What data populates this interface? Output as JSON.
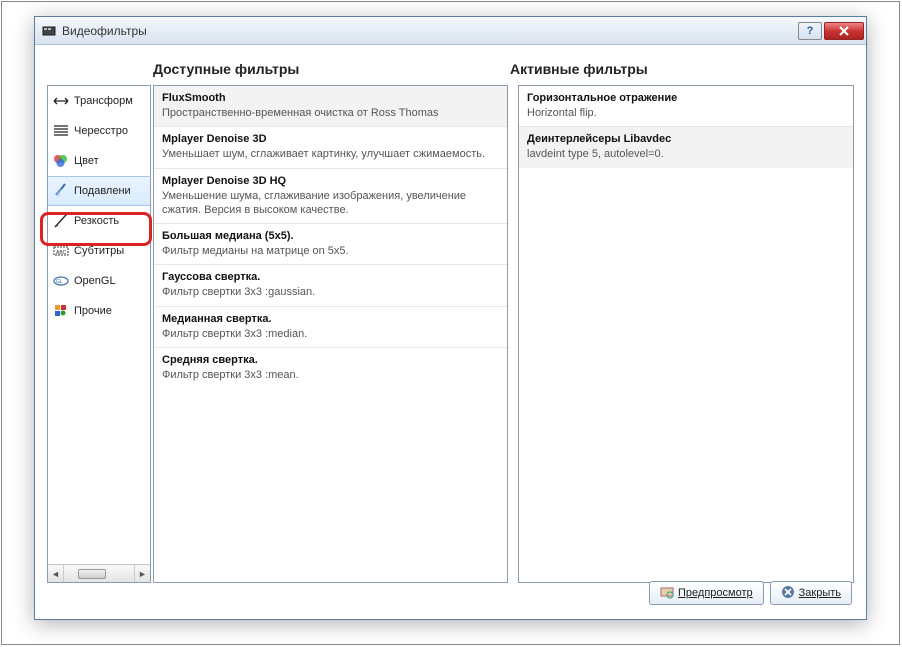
{
  "window": {
    "title": "Видеофильтры"
  },
  "headers": {
    "available": "Доступные фильтры",
    "active": "Активные фильтры"
  },
  "sidebar": {
    "items": [
      {
        "label": "Трансформ",
        "icon": "transform"
      },
      {
        "label": "Чересстро",
        "icon": "interlace"
      },
      {
        "label": "Цвет",
        "icon": "color"
      },
      {
        "label": "Подавлени",
        "icon": "noise"
      },
      {
        "label": "Резкость",
        "icon": "sharp"
      },
      {
        "label": "Субтитры",
        "icon": "subs"
      },
      {
        "label": "OpenGL",
        "icon": "opengl"
      },
      {
        "label": "Прочие",
        "icon": "other"
      }
    ]
  },
  "available": [
    {
      "name": "FluxSmooth",
      "desc": "Пространственно-временная очистка от Ross Thomas"
    },
    {
      "name": "Mplayer Denoise 3D",
      "desc": "Уменьшает шум, сглаживает картинку, улучшает сжимаемость."
    },
    {
      "name": "Mplayer Denoise 3D HQ",
      "desc": "Уменьшение шума, сглаживание изображения, увеличение сжатия. Версия в высоком качестве."
    },
    {
      "name": "Большая медиана (5x5).",
      "desc": "Фильтр медианы на матрице on 5x5."
    },
    {
      "name": "Гауссова свертка.",
      "desc": "Фильтр свертки 3x3 :gaussian."
    },
    {
      "name": "Медианная свертка.",
      "desc": "Фильтр свертки 3x3 :median."
    },
    {
      "name": "Средняя свертка.",
      "desc": "Фильтр свертки 3x3 :mean."
    }
  ],
  "active": [
    {
      "name": "Горизонтальное отражение",
      "desc": "Horizontal flip."
    },
    {
      "name": "Деинтерлейсеры Libavdec",
      "desc": "lavdeint type 5, autolevel=0."
    }
  ],
  "buttons": {
    "preview": "Предпросмотр",
    "close": "Закрыть"
  }
}
